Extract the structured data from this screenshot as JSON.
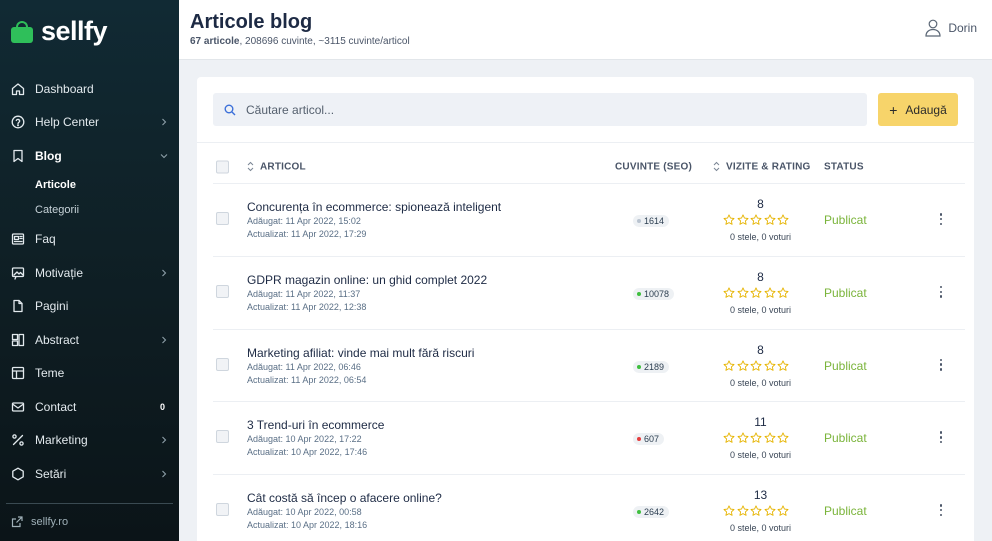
{
  "app": {
    "name": "sellfy",
    "accent": "#2fbf5a"
  },
  "sidebar": {
    "items": [
      {
        "id": "dashboard",
        "label": "Dashboard",
        "icon": "home-icon",
        "chevron": false
      },
      {
        "id": "help",
        "label": "Help Center",
        "icon": "help-circle-icon",
        "chevron": true
      },
      {
        "id": "blog",
        "label": "Blog",
        "icon": "bookmark-icon",
        "chevron": true,
        "active": true,
        "children": [
          {
            "label": "Articole",
            "active": true
          },
          {
            "label": "Categorii",
            "active": false
          }
        ]
      },
      {
        "id": "faq",
        "label": "Faq",
        "icon": "newspaper-icon",
        "chevron": false
      },
      {
        "id": "motivatie",
        "label": "Motivație",
        "icon": "chat-image-icon",
        "chevron": true
      },
      {
        "id": "pagini",
        "label": "Pagini",
        "icon": "file-icon",
        "chevron": false
      },
      {
        "id": "abstract",
        "label": "Abstract",
        "icon": "layout-icon",
        "chevron": true
      },
      {
        "id": "teme",
        "label": "Teme",
        "icon": "template-icon",
        "chevron": false
      },
      {
        "id": "contact",
        "label": "Contact",
        "icon": "mail-icon",
        "chevron": false,
        "badge": "0"
      },
      {
        "id": "marketing",
        "label": "Marketing",
        "icon": "percent-icon",
        "chevron": true
      },
      {
        "id": "setari",
        "label": "Setări",
        "icon": "hexagon-icon",
        "chevron": true
      }
    ],
    "footer_link": "sellfy.ro"
  },
  "header": {
    "title": "Articole blog",
    "subtitle_bold": "67 articole",
    "subtitle_rest": ", 208696 cuvinte, ~3115 cuvinte/articol",
    "user_name": "Dorin"
  },
  "toolbar": {
    "search_placeholder": "Căutare articol...",
    "add_label": "Adaugă"
  },
  "table": {
    "columns": {
      "article": "ARTICOL",
      "words": "CUVINTE (SEO)",
      "visits": "VIZITE & RATING",
      "status": "STATUS"
    },
    "rows": [
      {
        "title": "Concurența în ecommerce: spionează inteligent",
        "added": "Adăugat: 11 Apr 2022, 15:02",
        "updated": "Actualizat: 11 Apr 2022, 17:29",
        "words": "1614",
        "words_color": "#b9c3cf",
        "visits": "8",
        "rating": 0,
        "rating_text": "0 stele, 0 voturi",
        "status": "Publicat"
      },
      {
        "title": "GDPR magazin online: un ghid complet 2022",
        "added": "Adăugat: 11 Apr 2022, 11:37",
        "updated": "Actualizat: 11 Apr 2022, 12:38",
        "words": "10078",
        "words_color": "#3fbf3f",
        "visits": "8",
        "rating": 0,
        "rating_text": "0 stele, 0 voturi",
        "status": "Publicat"
      },
      {
        "title": "Marketing afiliat: vinde mai mult fără riscuri",
        "added": "Adăugat: 11 Apr 2022, 06:46",
        "updated": "Actualizat: 11 Apr 2022, 06:54",
        "words": "2189",
        "words_color": "#3fbf3f",
        "visits": "8",
        "rating": 0,
        "rating_text": "0 stele, 0 voturi",
        "status": "Publicat"
      },
      {
        "title": "3 Trend-uri în ecommerce",
        "added": "Adăugat: 10 Apr 2022, 17:22",
        "updated": "Actualizat: 10 Apr 2022, 17:46",
        "words": "607",
        "words_color": "#e53e3e",
        "visits": "11",
        "rating": 0,
        "rating_text": "0 stele, 0 voturi",
        "status": "Publicat"
      },
      {
        "title": "Cât costă să încep o afacere online?",
        "added": "Adăugat: 10 Apr 2022, 00:58",
        "updated": "Actualizat: 10 Apr 2022, 18:16",
        "words": "2642",
        "words_color": "#3fbf3f",
        "visits": "13",
        "rating": 0,
        "rating_text": "0 stele, 0 voturi",
        "status": "Publicat"
      }
    ]
  }
}
